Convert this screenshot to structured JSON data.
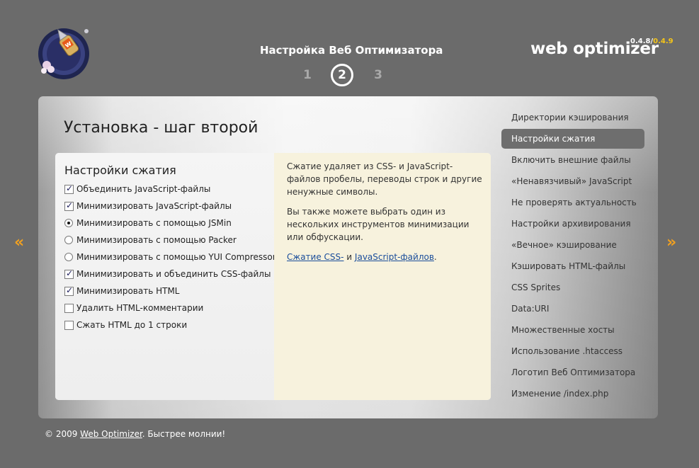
{
  "header": {
    "title": "Настройка Веб Оптимизатора",
    "steps": [
      "1",
      "2",
      "3"
    ],
    "current_step": "2",
    "brand": "web optimizer",
    "version_old": "0.4.8/",
    "version_new": "0.4.9"
  },
  "nav": {
    "prev_icon": "«",
    "next_icon": "»"
  },
  "page": {
    "title": "Установка - шаг второй"
  },
  "options": {
    "section_title": "Настройки сжатия",
    "items": [
      {
        "type": "checkbox",
        "label": "Объединить JavaScript-файлы",
        "checked": true
      },
      {
        "type": "checkbox",
        "label": "Минимизировать JavaScript-файлы",
        "checked": true
      },
      {
        "type": "radio",
        "label": "Минимизировать с помощью JSMin",
        "checked": true
      },
      {
        "type": "radio",
        "label": "Минимизировать с помощью Packer",
        "checked": false
      },
      {
        "type": "radio",
        "label": "Минимизировать с помощью YUI Compressor",
        "checked": false
      },
      {
        "type": "checkbox",
        "label": "Минимизировать и объединить CSS-файлы",
        "checked": true
      },
      {
        "type": "checkbox",
        "label": "Минимизировать HTML",
        "checked": true
      },
      {
        "type": "checkbox",
        "label": "Удалить HTML-комментарии",
        "checked": false
      },
      {
        "type": "checkbox",
        "label": "Сжать HTML до 1 строки",
        "checked": false
      }
    ]
  },
  "help": {
    "p1": "Сжатие удаляет из CSS- и JavaScript-файлов пробелы, переводы строк и другие ненужные символы.",
    "p2": "Вы также можете выбрать один из нескольких инструментов минимизации или обфускации.",
    "link1": "Сжатие CSS-",
    "and": " и ",
    "link2": "JavaScript-файлов",
    "dot": "."
  },
  "sidebar": {
    "items": [
      "Директории кэширования",
      "Настройки сжатия",
      "Включить внешние файлы",
      "«Ненавязчивый» JavaScript",
      "Не проверять актуальность",
      "Настройки архивирования",
      "«Вечное» кэширование",
      "Кэшировать HTML-файлы",
      "CSS Sprites",
      "Data:URI",
      "Множественные хосты",
      "Использование .htaccess",
      "Логотип Веб Оптимизатора",
      "Изменение /index.php"
    ],
    "active_index": 1
  },
  "footer": {
    "prefix": "© 2009 ",
    "link": "Web Optimizer",
    "suffix": ". Быстрее молнии!"
  },
  "colors": {
    "background": "#6b6b6b",
    "accent_arrow": "#f0a020",
    "version_new": "#f5c518",
    "help_bg": "#f7f2dd",
    "link": "#1a4d9a",
    "sidebar_active_bg": "#6e6e6e"
  }
}
